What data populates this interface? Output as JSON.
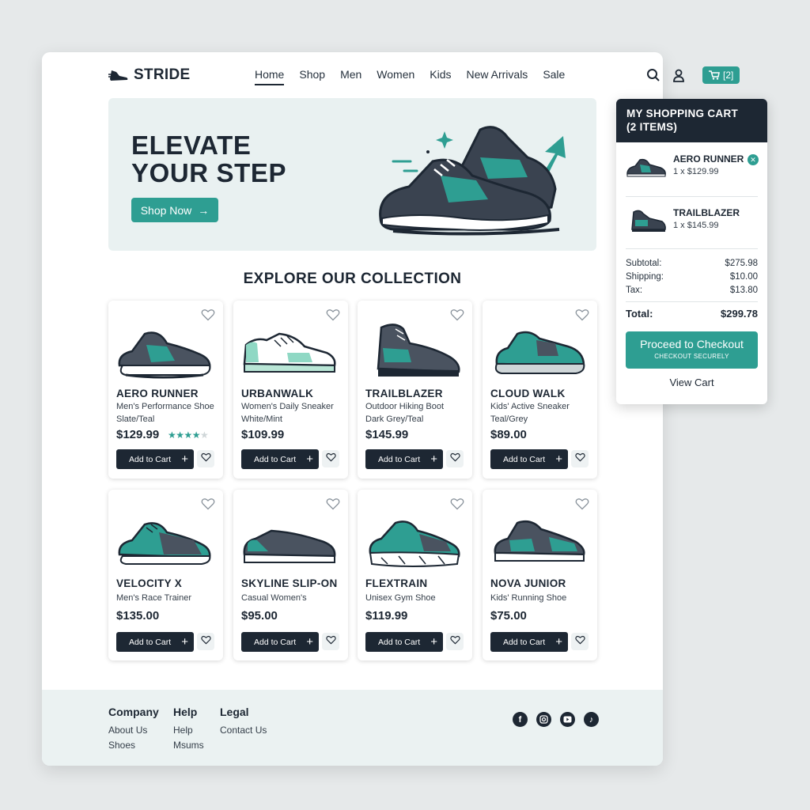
{
  "brand": {
    "name": "STRIDE"
  },
  "nav": {
    "items": [
      "Home",
      "Shop",
      "Men",
      "Women",
      "Kids",
      "New Arrivals",
      "Sale"
    ],
    "active": "Home"
  },
  "header": {
    "cart_count": "[2]"
  },
  "hero": {
    "title_line1": "ELEVATE",
    "title_line2": "YOUR STEP",
    "cta": "Shop Now"
  },
  "collection": {
    "title": "EXPLORE OUR COLLECTION",
    "add_label": "Add to Cart",
    "products": [
      {
        "name": "AERO RUNNER",
        "desc1": "Men's Performance Shoe",
        "desc2": "Slate/Teal",
        "price": "$129.99",
        "rating": 4
      },
      {
        "name": "URBANWALK",
        "desc1": "Women's Daily Sneaker",
        "desc2": "White/Mint",
        "price": "$109.99"
      },
      {
        "name": "TRAILBLAZER",
        "desc1": "Outdoor Hiking Boot",
        "desc2": "Dark Grey/Teal",
        "price": "$145.99"
      },
      {
        "name": "CLOUD WALK",
        "desc1": "Kids' Active Sneaker",
        "desc2": "Teal/Grey",
        "price": "$89.00"
      },
      {
        "name": "VELOCITY X",
        "desc1": "Men's Race Trainer",
        "desc2": "",
        "price": "$135.00"
      },
      {
        "name": "SKYLINE SLIP-ON",
        "desc1": "Casual Women's",
        "desc2": "",
        "price": "$95.00"
      },
      {
        "name": "FLEXTRAIN",
        "desc1": "Unisex Gym Shoe",
        "desc2": "",
        "price": "$119.99"
      },
      {
        "name": "NOVA JUNIOR",
        "desc1": "Kids' Running Shoe",
        "desc2": "",
        "price": "$75.00"
      }
    ]
  },
  "cart": {
    "title_line1": "MY SHOPPING CART",
    "title_line2": "(2 ITEMS)",
    "items": [
      {
        "name": "AERO RUNNER",
        "qty": "1 x $129.99"
      },
      {
        "name": "TRAILBLAZER",
        "qty": "1 x $145.99"
      }
    ],
    "subtotal_label": "Subtotal:",
    "subtotal": "$275.98",
    "shipping_label": "Shipping:",
    "shipping": "$10.00",
    "tax_label": "Tax:",
    "tax": "$13.80",
    "total_label": "Total:",
    "total": "$299.78",
    "checkout_label": "Proceed to Checkout",
    "checkout_sub": "CHECKOUT SECURELY",
    "view_cart": "View Cart"
  },
  "footer": {
    "columns": [
      {
        "heading": "Company",
        "links": [
          "About Us",
          "Shoes"
        ]
      },
      {
        "heading": "Help",
        "links": [
          "Help",
          "Msums"
        ]
      },
      {
        "heading": "Legal",
        "links": [
          "Contact Us"
        ]
      }
    ],
    "social": [
      "facebook-icon",
      "instagram-icon",
      "youtube-icon",
      "tiktok-icon"
    ]
  },
  "colors": {
    "primary": "#1d2733",
    "accent": "#2e9e92",
    "hero_bg": "#e9f1f1"
  }
}
